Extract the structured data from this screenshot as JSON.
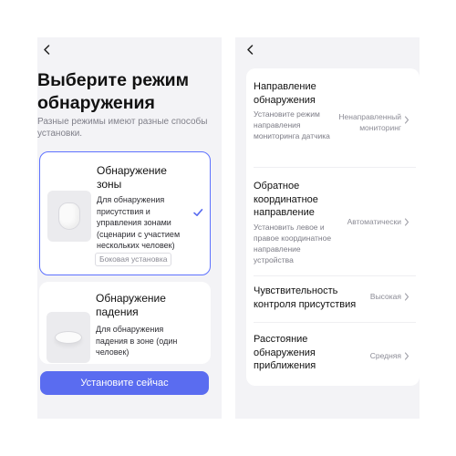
{
  "left_screen": {
    "title": "Выберите режим обнаружения",
    "subtitle": "Разные режимы имеют разные способы установки.",
    "modes": [
      {
        "name": "Обнаружение зоны",
        "description": "Для обнаружения присутствия и управления зонами (сценарии с участием нескольких человек)",
        "tag": "Боковая установка",
        "selected": true
      },
      {
        "name": "Обнаружение падения",
        "description": "Для обнаружения падения в зоне (один человек)",
        "selected": false
      }
    ],
    "cta_label": "Установите сейчас"
  },
  "right_screen": {
    "settings": [
      {
        "title": "Направление обнаружения",
        "description": "Установите режим направления мониторинга датчика",
        "value": "Ненаправленный мониторинг"
      },
      {
        "title": "Обратное координатное направление",
        "description": "Установить левое и правое координатное направление устройства",
        "value": "Автоматически"
      },
      {
        "title": "Чувствительность контроля присутствия",
        "value": "Высокая"
      },
      {
        "title": "Расстояние обнаружения приближения",
        "value": "Средняя"
      }
    ]
  },
  "colors": {
    "accent": "#5a6cf0",
    "selected_border": "#5e72ff",
    "screen_background": "#f3f3f6",
    "card_background": "#ffffff"
  },
  "icons": [
    "back-arrow-icon",
    "checkmark-icon",
    "chevron-right-icon",
    "zone-sensor-image",
    "fall-sensor-image"
  ]
}
